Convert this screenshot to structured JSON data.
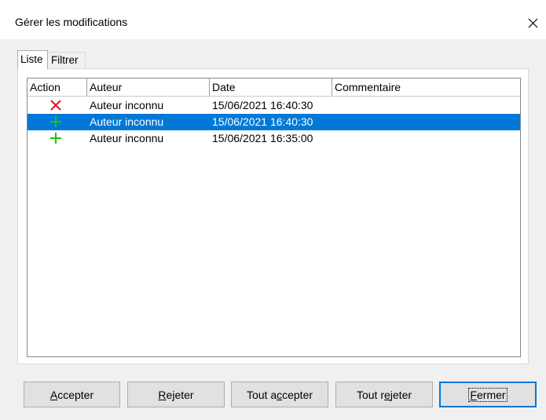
{
  "window": {
    "title": "Gérer les modifications"
  },
  "tabs": [
    {
      "label": "Liste",
      "active": true
    },
    {
      "label": "Filtrer",
      "active": false
    }
  ],
  "table": {
    "columns": [
      "Action",
      "Auteur",
      "Date",
      "Commentaire"
    ],
    "rows": [
      {
        "action_icon": "reject-x-icon",
        "action_color": "#e81123",
        "author": "Auteur inconnu",
        "date": "15/06/2021 16:40:30",
        "comment": "",
        "selected": false
      },
      {
        "action_icon": "insert-plus-icon",
        "action_color": "#16c60c",
        "author": "Auteur inconnu",
        "date": "15/06/2021 16:40:30",
        "comment": "",
        "selected": true
      },
      {
        "action_icon": "insert-plus-icon",
        "action_color": "#16c60c",
        "author": "Auteur inconnu",
        "date": "15/06/2021 16:35:00",
        "comment": "",
        "selected": false
      }
    ]
  },
  "buttons": {
    "accept": {
      "label": "Accepter",
      "mnemonic": "A"
    },
    "reject": {
      "label": "Rejeter",
      "mnemonic": "R"
    },
    "accept_all": {
      "label": "Tout accepter",
      "mnemonic": "c"
    },
    "reject_all": {
      "label": "Tout rejeter",
      "mnemonic": "e"
    },
    "close": {
      "label": "Fermer",
      "mnemonic": "F"
    }
  },
  "colors": {
    "selection": "#0078d7",
    "reject": "#e81123",
    "insert": "#16c60c"
  }
}
